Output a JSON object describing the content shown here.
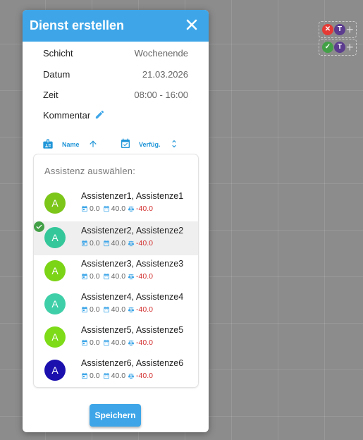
{
  "dialog": {
    "title": "Dienst erstellen",
    "close_icon": "close-icon",
    "fields": {
      "schicht": {
        "label": "Schicht",
        "value": "Wochenende"
      },
      "datum": {
        "label": "Datum",
        "value": "21.03.2026"
      },
      "zeit": {
        "label": "Zeit",
        "value": "08:00 - 16:00"
      },
      "kommentar": {
        "label": "Kommentar",
        "icon": "pencil-icon"
      }
    },
    "sort": {
      "name_label": "Name",
      "name_direction": "ascending",
      "verfuegbar_label": "Verfüg.",
      "verfuegbar_direction": "unsorted"
    },
    "list_header": "Assistenz auswählen:",
    "items": [
      {
        "initial": "A",
        "name": "Assistenzer1, Assistenze1",
        "stat1": "0.0",
        "stat2": "40.0",
        "stat3": "-40.0",
        "avatar_color": "#7cc61a",
        "selected": false
      },
      {
        "initial": "A",
        "name": "Assistenzer2, Assistenze2",
        "stat1": "0.0",
        "stat2": "40.0",
        "stat3": "-40.0",
        "avatar_color": "#34c79a",
        "selected": true
      },
      {
        "initial": "A",
        "name": "Assistenzer3, Assistenze3",
        "stat1": "0.0",
        "stat2": "40.0",
        "stat3": "-40.0",
        "avatar_color": "#7cd416",
        "selected": false
      },
      {
        "initial": "A",
        "name": "Assistenzer4, Assistenze4",
        "stat1": "0.0",
        "stat2": "40.0",
        "stat3": "-40.0",
        "avatar_color": "#3fcfa8",
        "selected": false
      },
      {
        "initial": "A",
        "name": "Assistenzer5, Assistenze5",
        "stat1": "0.0",
        "stat2": "40.0",
        "stat3": "-40.0",
        "avatar_color": "#7ddb18",
        "selected": false
      },
      {
        "initial": "A",
        "name": "Assistenzer6, Assistenze6",
        "stat1": "0.0",
        "stat2": "40.0",
        "stat3": "-40.0",
        "avatar_color": "#1b0fae",
        "selected": false
      }
    ],
    "save_label": "Speichern"
  },
  "side_widgets": [
    {
      "status": "declined",
      "avatar_initial": "T",
      "plus": "+"
    },
    {
      "status": "accepted",
      "avatar_initial": "T",
      "plus": "+"
    }
  ],
  "colors": {
    "accent": "#3ea6e8",
    "negative": "#d32f2f",
    "check": "#43a047",
    "declined": "#e53935",
    "avatar_purple": "#5b3c8f"
  }
}
